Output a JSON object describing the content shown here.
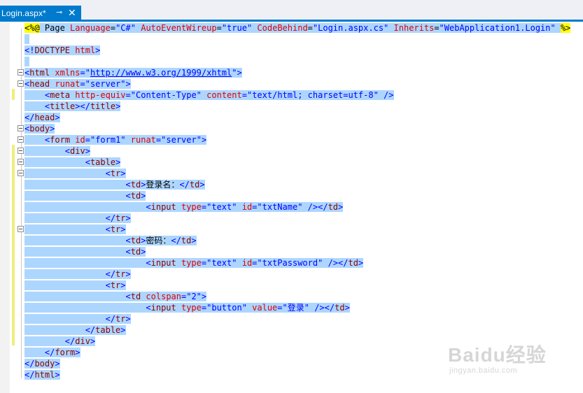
{
  "tab": {
    "title": "Login.aspx*",
    "pin_icon": "pin-icon",
    "close_icon": "close-icon"
  },
  "code": [
    [
      [
        "dir",
        "<%@"
      ],
      [
        "txt",
        " Page "
      ],
      [
        "attr",
        "Language"
      ],
      [
        "txt",
        "="
      ],
      [
        "str",
        "\"C#\""
      ],
      [
        "txt",
        " "
      ],
      [
        "attr",
        "AutoEventWireup"
      ],
      [
        "txt",
        "="
      ],
      [
        "str",
        "\"true\""
      ],
      [
        "txt",
        " "
      ],
      [
        "attr",
        "CodeBehind"
      ],
      [
        "txt",
        "="
      ],
      [
        "str",
        "\"Login.aspx.cs\""
      ],
      [
        "txt",
        " "
      ],
      [
        "attr",
        "Inherits"
      ],
      [
        "txt",
        "="
      ],
      [
        "str",
        "\"WebApplication1.Login\""
      ],
      [
        "txt",
        " "
      ],
      [
        "dir",
        "%>"
      ]
    ],
    [],
    [
      [
        "punct",
        "<!"
      ],
      [
        "tag",
        "DOCTYPE"
      ],
      [
        "txt",
        " "
      ],
      [
        "attr",
        "html"
      ],
      [
        "punct",
        ">"
      ]
    ],
    [],
    [
      [
        "punct",
        "<"
      ],
      [
        "tag",
        "html"
      ],
      [
        "txt",
        " "
      ],
      [
        "attr",
        "xmlns"
      ],
      [
        "punct",
        "="
      ],
      [
        "punct",
        "\""
      ],
      [
        "url",
        "http://www.w3.org/1999/xhtml"
      ],
      [
        "punct",
        "\""
      ],
      [
        "punct",
        ">"
      ]
    ],
    [
      [
        "punct",
        "<"
      ],
      [
        "tag",
        "head"
      ],
      [
        "txt",
        " "
      ],
      [
        "attr",
        "runat"
      ],
      [
        "punct",
        "="
      ],
      [
        "str",
        "\"server\""
      ],
      [
        "punct",
        ">"
      ]
    ],
    [
      [
        "txt",
        "    "
      ],
      [
        "punct",
        "<"
      ],
      [
        "tag",
        "meta"
      ],
      [
        "txt",
        " "
      ],
      [
        "attr",
        "http-equiv"
      ],
      [
        "punct",
        "="
      ],
      [
        "str",
        "\"Content-Type\""
      ],
      [
        "txt",
        " "
      ],
      [
        "attr",
        "content"
      ],
      [
        "punct",
        "="
      ],
      [
        "str",
        "\"text/html; charset=utf-8\""
      ],
      [
        "txt",
        " "
      ],
      [
        "punct",
        "/>"
      ]
    ],
    [
      [
        "txt",
        "    "
      ],
      [
        "punct",
        "<"
      ],
      [
        "tag",
        "title"
      ],
      [
        "punct",
        "></"
      ],
      [
        "tag",
        "title"
      ],
      [
        "punct",
        ">"
      ]
    ],
    [
      [
        "punct",
        "</"
      ],
      [
        "tag",
        "head"
      ],
      [
        "punct",
        ">"
      ]
    ],
    [
      [
        "punct",
        "<"
      ],
      [
        "tag",
        "body"
      ],
      [
        "punct",
        ">"
      ]
    ],
    [
      [
        "txt",
        "    "
      ],
      [
        "punct",
        "<"
      ],
      [
        "tag",
        "form"
      ],
      [
        "txt",
        " "
      ],
      [
        "attr",
        "id"
      ],
      [
        "punct",
        "="
      ],
      [
        "str",
        "\"form1\""
      ],
      [
        "txt",
        " "
      ],
      [
        "attr",
        "runat"
      ],
      [
        "punct",
        "="
      ],
      [
        "str",
        "\"server\""
      ],
      [
        "punct",
        ">"
      ]
    ],
    [
      [
        "txt",
        "        "
      ],
      [
        "punct",
        "<"
      ],
      [
        "tag",
        "div"
      ],
      [
        "punct",
        ">"
      ]
    ],
    [
      [
        "txt",
        "            "
      ],
      [
        "punct",
        "<"
      ],
      [
        "tag",
        "table"
      ],
      [
        "punct",
        ">"
      ]
    ],
    [
      [
        "txt",
        "                "
      ],
      [
        "punct",
        "<"
      ],
      [
        "tag",
        "tr"
      ],
      [
        "punct",
        ">"
      ]
    ],
    [
      [
        "txt",
        "                    "
      ],
      [
        "punct",
        "<"
      ],
      [
        "tag",
        "td"
      ],
      [
        "punct",
        ">"
      ],
      [
        "txt",
        "登录名："
      ],
      [
        "punct",
        "</"
      ],
      [
        "tag",
        "td"
      ],
      [
        "punct",
        ">"
      ]
    ],
    [
      [
        "txt",
        "                    "
      ],
      [
        "punct",
        "<"
      ],
      [
        "tag",
        "td"
      ],
      [
        "punct",
        ">"
      ]
    ],
    [
      [
        "txt",
        "                        "
      ],
      [
        "punct",
        "<"
      ],
      [
        "tag",
        "input"
      ],
      [
        "txt",
        " "
      ],
      [
        "attr",
        "type"
      ],
      [
        "punct",
        "="
      ],
      [
        "str",
        "\"text\""
      ],
      [
        "txt",
        " "
      ],
      [
        "attr",
        "id"
      ],
      [
        "punct",
        "="
      ],
      [
        "str",
        "\"txtName\""
      ],
      [
        "txt",
        " "
      ],
      [
        "punct",
        "/></"
      ],
      [
        "tag",
        "td"
      ],
      [
        "punct",
        ">"
      ]
    ],
    [
      [
        "txt",
        "                "
      ],
      [
        "punct",
        "</"
      ],
      [
        "tag",
        "tr"
      ],
      [
        "punct",
        ">"
      ]
    ],
    [
      [
        "txt",
        "                "
      ],
      [
        "punct",
        "<"
      ],
      [
        "tag",
        "tr"
      ],
      [
        "punct",
        ">"
      ]
    ],
    [
      [
        "txt",
        "                    "
      ],
      [
        "punct",
        "<"
      ],
      [
        "tag",
        "td"
      ],
      [
        "punct",
        ">"
      ],
      [
        "txt",
        "密码："
      ],
      [
        "punct",
        "</"
      ],
      [
        "tag",
        "td"
      ],
      [
        "punct",
        ">"
      ]
    ],
    [
      [
        "txt",
        "                    "
      ],
      [
        "punct",
        "<"
      ],
      [
        "tag",
        "td"
      ],
      [
        "punct",
        ">"
      ]
    ],
    [
      [
        "txt",
        "                        "
      ],
      [
        "punct",
        "<"
      ],
      [
        "tag",
        "input"
      ],
      [
        "txt",
        " "
      ],
      [
        "attr",
        "type"
      ],
      [
        "punct",
        "="
      ],
      [
        "str",
        "\"text\""
      ],
      [
        "txt",
        " "
      ],
      [
        "attr",
        "id"
      ],
      [
        "punct",
        "="
      ],
      [
        "str",
        "\"txtPassword\""
      ],
      [
        "txt",
        " "
      ],
      [
        "punct",
        "/></"
      ],
      [
        "tag",
        "td"
      ],
      [
        "punct",
        ">"
      ]
    ],
    [
      [
        "txt",
        "                "
      ],
      [
        "punct",
        "</"
      ],
      [
        "tag",
        "tr"
      ],
      [
        "punct",
        ">"
      ]
    ],
    [
      [
        "txt",
        "                "
      ],
      [
        "punct",
        "<"
      ],
      [
        "tag",
        "tr"
      ],
      [
        "punct",
        ">"
      ]
    ],
    [
      [
        "txt",
        "                    "
      ],
      [
        "punct",
        "<"
      ],
      [
        "tag",
        "td"
      ],
      [
        "txt",
        " "
      ],
      [
        "attr",
        "colspan"
      ],
      [
        "punct",
        "="
      ],
      [
        "str",
        "\"2\""
      ],
      [
        "punct",
        ">"
      ]
    ],
    [
      [
        "txt",
        "                        "
      ],
      [
        "punct",
        "<"
      ],
      [
        "tag",
        "input"
      ],
      [
        "txt",
        " "
      ],
      [
        "attr",
        "type"
      ],
      [
        "punct",
        "="
      ],
      [
        "str",
        "\"button\""
      ],
      [
        "txt",
        " "
      ],
      [
        "attr",
        "value"
      ],
      [
        "punct",
        "="
      ],
      [
        "str",
        "\"登录\""
      ],
      [
        "txt",
        " "
      ],
      [
        "punct",
        "/></"
      ],
      [
        "tag",
        "td"
      ],
      [
        "punct",
        ">"
      ]
    ],
    [
      [
        "txt",
        "                "
      ],
      [
        "punct",
        "</"
      ],
      [
        "tag",
        "tr"
      ],
      [
        "punct",
        ">"
      ]
    ],
    [
      [
        "txt",
        "            "
      ],
      [
        "punct",
        "</"
      ],
      [
        "tag",
        "table"
      ],
      [
        "punct",
        ">"
      ]
    ],
    [
      [
        "txt",
        "        "
      ],
      [
        "punct",
        "</"
      ],
      [
        "tag",
        "div"
      ],
      [
        "punct",
        ">"
      ]
    ],
    [
      [
        "txt",
        "    "
      ],
      [
        "punct",
        "</"
      ],
      [
        "tag",
        "form"
      ],
      [
        "punct",
        ">"
      ]
    ],
    [
      [
        "punct",
        "</"
      ],
      [
        "tag",
        "body"
      ],
      [
        "punct",
        ">"
      ]
    ],
    [
      [
        "punct",
        "</"
      ],
      [
        "tag",
        "html"
      ],
      [
        "punct",
        ">"
      ]
    ]
  ],
  "watermark": {
    "logo": "Baidu经验",
    "sub": "jingyan.baidu.com"
  }
}
